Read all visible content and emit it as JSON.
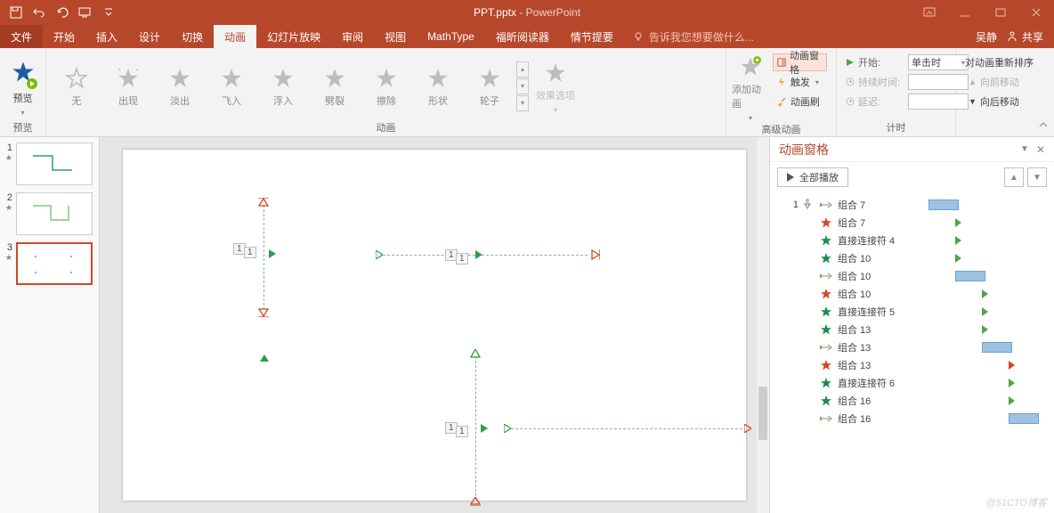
{
  "title": {
    "filename": "PPT.pptx",
    "app": "PowerPoint"
  },
  "tabs": {
    "file": "文件",
    "items": [
      "开始",
      "插入",
      "设计",
      "切换",
      "动画",
      "幻灯片放映",
      "审阅",
      "视图",
      "MathType",
      "福昕阅读器",
      "情节提要"
    ],
    "active": "动画",
    "tellme": "告诉我您想要做什么...",
    "user": "吴静",
    "share": "共享"
  },
  "ribbon": {
    "preview": {
      "btn": "预览",
      "group": "预览"
    },
    "anims": {
      "items": [
        "无",
        "出现",
        "淡出",
        "飞入",
        "浮入",
        "劈裂",
        "擦除",
        "形状",
        "轮子"
      ],
      "group": "动画"
    },
    "effectOptions": "效果选项",
    "advanced": {
      "add": "添加动画",
      "pane": "动画窗格",
      "trigger": "触发",
      "painter": "动画刷",
      "group": "高级动画"
    },
    "timing": {
      "start_lbl": "开始:",
      "start_val": "单击时",
      "duration_lbl": "持续时间:",
      "delay_lbl": "延迟:",
      "group": "计时"
    },
    "reorder": {
      "title": "对动画重新排序",
      "fwd": "向前移动",
      "back": "向后移动"
    }
  },
  "slides": [
    {
      "n": "1",
      "star": "★"
    },
    {
      "n": "2",
      "star": "★"
    },
    {
      "n": "3",
      "star": "★"
    }
  ],
  "animPane": {
    "title": "动画窗格",
    "playAll": "全部播放",
    "rows": [
      {
        "seq": "1",
        "click": true,
        "type": "motion",
        "name": "组合 7",
        "bar": true,
        "barOffset": 0
      },
      {
        "type": "exit-star",
        "name": "组合 7",
        "tri": "green",
        "triOffset": 30
      },
      {
        "type": "entry-star",
        "name": "直接连接符 4",
        "tri": "green",
        "triOffset": 30
      },
      {
        "type": "entry-star",
        "name": "组合 10",
        "tri": "green",
        "triOffset": 30
      },
      {
        "type": "motion",
        "name": "组合 10",
        "bar": true,
        "barOffset": 30
      },
      {
        "type": "exit-star",
        "name": "组合 10",
        "tri": "green",
        "triOffset": 60
      },
      {
        "type": "entry-star",
        "name": "直接连接符 5",
        "tri": "green",
        "triOffset": 60
      },
      {
        "type": "entry-star",
        "name": "组合 13",
        "tri": "green",
        "triOffset": 60
      },
      {
        "type": "motion",
        "name": "组合 13",
        "bar": true,
        "barOffset": 60
      },
      {
        "type": "exit-star",
        "name": "组合 13",
        "tri": "red",
        "triOffset": 90
      },
      {
        "type": "entry-star",
        "name": "直接连接符 6",
        "tri": "green",
        "triOffset": 90
      },
      {
        "type": "entry-star",
        "name": "组合 16",
        "tri": "green",
        "triOffset": 90
      },
      {
        "type": "motion",
        "name": "组合 16",
        "bar": true,
        "barOffset": 90
      }
    ]
  },
  "watermark": "@51CTO博客"
}
